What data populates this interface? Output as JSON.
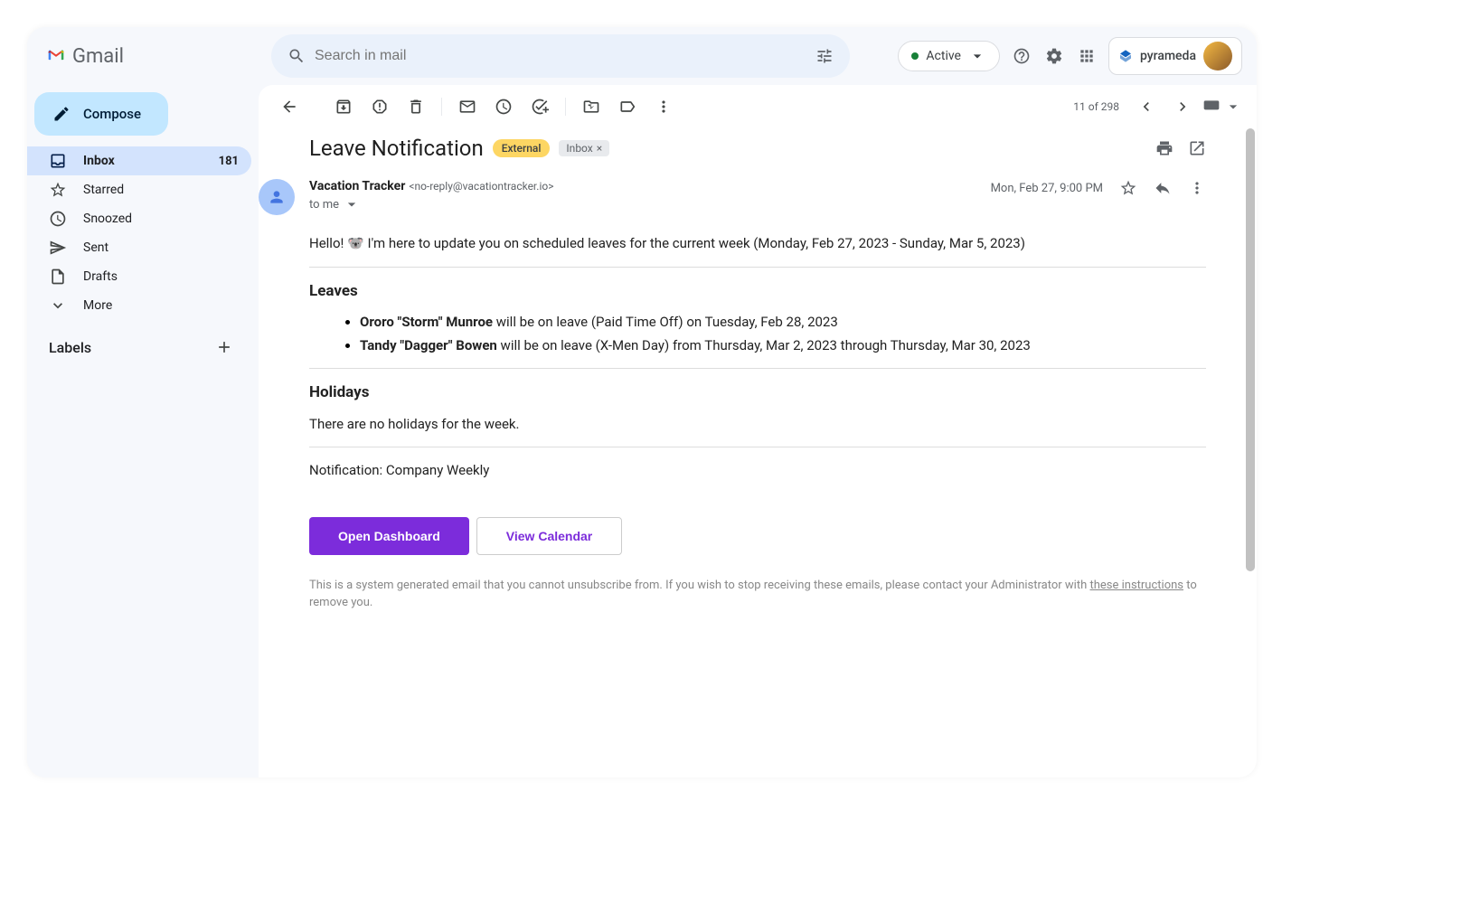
{
  "header": {
    "app_name": "Gmail",
    "search_placeholder": "Search in mail",
    "status_label": "Active",
    "org_name": "pyrameda"
  },
  "sidebar": {
    "compose_label": "Compose",
    "items": [
      {
        "label": "Inbox",
        "count": "181"
      },
      {
        "label": "Starred"
      },
      {
        "label": "Snoozed"
      },
      {
        "label": "Sent"
      },
      {
        "label": "Drafts"
      },
      {
        "label": "More"
      }
    ],
    "labels_heading": "Labels"
  },
  "toolbar": {
    "pagination": "11 of 298"
  },
  "email": {
    "subject": "Leave Notification",
    "badge_external": "External",
    "badge_inbox": "Inbox",
    "sender_name": "Vacation Tracker",
    "sender_email": "<no-reply@vacationtracker.io>",
    "to_line": "to me",
    "date": "Mon, Feb 27, 9:00 PM",
    "greeting": "Hello! 🐨 I'm here to update you on scheduled leaves for the current week (Monday, Feb 27, 2023 - Sunday, Mar 5, 2023)",
    "leaves_heading": "Leaves",
    "leaves": [
      {
        "name": "Ororo \"Storm\" Munroe",
        "text": " will be on leave (Paid Time Off) on Tuesday, Feb 28, 2023"
      },
      {
        "name": "Tandy \"Dagger\" Bowen",
        "text": " will be on leave (X-Men Day) from Thursday, Mar 2, 2023 through Thursday, Mar 30, 2023"
      }
    ],
    "holidays_heading": "Holidays",
    "holidays_text": "There are no holidays for the week.",
    "notification_line": "Notification: Company Weekly",
    "btn_primary": "Open Dashboard",
    "btn_secondary": "View Calendar",
    "footer_pre": "This is a system generated email that you cannot unsubscribe from. If you wish to stop receiving these emails, please contact your Administrator with ",
    "footer_link": "these instructions",
    "footer_post": " to remove you."
  }
}
